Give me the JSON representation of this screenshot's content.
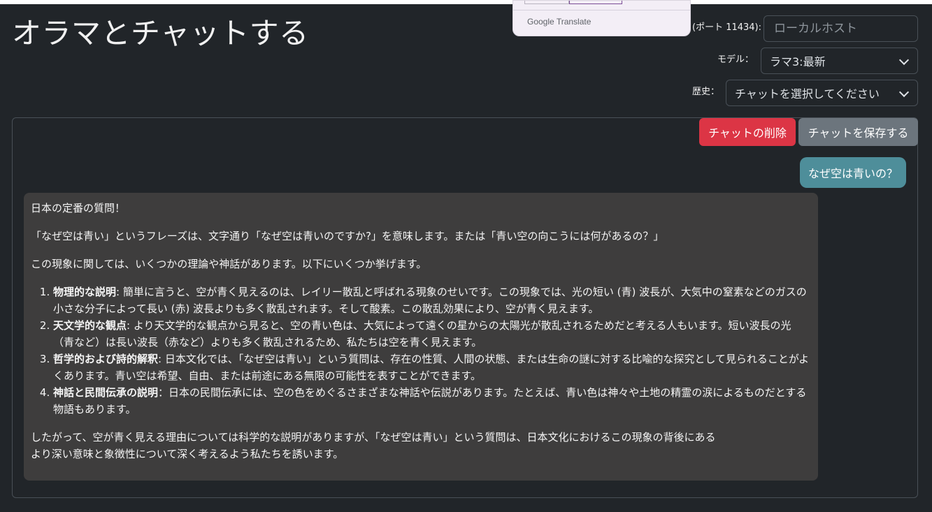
{
  "page": {
    "title": "オラマとチャットする"
  },
  "translate_popup": {
    "brand_google": "Google",
    "brand_translate": "Translate"
  },
  "settings": {
    "host_label": "(ポート 11434):",
    "host_placeholder": "ローカルホスト",
    "model_label": "モデル：",
    "model_value": "ラマ3:最新",
    "history_label": "歴史：",
    "history_value": "チャットを選択してください"
  },
  "chat": {
    "delete_label": "チャットの削除",
    "save_label": "チャットを保存する",
    "user_message": "なぜ空は青いの？",
    "response": {
      "intro1": "日本の定番の質問！",
      "intro2": "「なぜ空は青い」というフレーズは、文字通り「なぜ空は青いのですか?」を意味します。または「青い空の向こうには何があるの？」",
      "intro3": "この現象に関しては、いくつかの理論や神話があります。以下にいくつか挙げます。",
      "items": [
        {
          "title": "物理的な説明",
          "text": ": 簡単に言うと、空が青く見えるのは、レイリー散乱と呼ばれる現象のせいです。この現象では、光の短い (青) 波長が、大気中の窒素などのガスの小さな分子によって長い (赤) 波長よりも多く散乱されます。そして酸素。この散乱効果により、空が青く見えます。"
        },
        {
          "title": "天文学的な観点",
          "text": ": より天文学的な観点から見ると、空の青い色は、大気によって遠くの星からの太陽光が散乱されるためだと考える人もいます。短い波長の光（青など）は長い波長（赤など）よりも多く散乱されるため、私たちは空を青く見えます。"
        },
        {
          "title": "哲学的および詩的解釈",
          "text": ": 日本文化では、「なぜ空は青い」という質問は、存在の性質、人間の状態、または生命の謎に対する比喩的な探究として見られることがよくあります。青い空は希望、自由、または前途にある無限の可能性を表すことができます。"
        },
        {
          "title": "神話と民間伝承の説明",
          "text": "：日本の民間伝承には、空の色をめぐるさまざまな神話や伝説があります。たとえば、青い色は神々や土地の精霊の涙によるものだとする物語もあります。"
        }
      ],
      "conclusion_line1": "したがって、空が青く見える理由については科学的な説明がありますが、「なぜ空は青い」という質問は、日本文化におけるこの現象の背後にある",
      "conclusion_line2": "より深い意味と象徴性について深く考えるよう私たちを誘います。"
    }
  }
}
